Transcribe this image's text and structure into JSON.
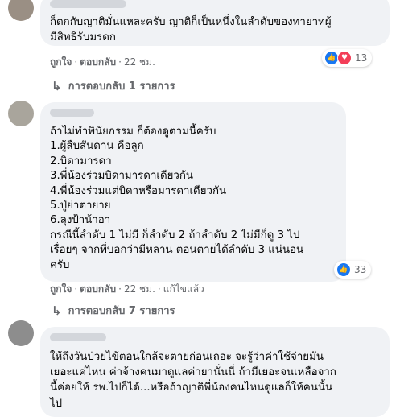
{
  "colors": {
    "bubble": "#f0f2f5",
    "meta_text": "#65676b",
    "like_blue": "#1877f2",
    "love_red": "#f33e58"
  },
  "comments": [
    {
      "lines": [
        "ก็ตกกับญาติมั่นแหละครับ ญาติก็เป็นหนึ่งในลำดับของทายาทผู้",
        "มีสิทธิรับมรดก"
      ],
      "actions": {
        "like": "ถูกใจ",
        "reply": "ตอบกลับ",
        "time": "22 ชม."
      },
      "reactions": {
        "icons": [
          "like-icon",
          "love-icon"
        ],
        "count": "13"
      },
      "replies_label": "การตอบกลับ 1 รายการ"
    },
    {
      "lines": [
        "ถ้าไม่ทำพินัยกรรม ก็ต้องดูตามนี้ครับ",
        "1.ผู้สืบสันดาน คือลูก",
        "2.บิดามารดา",
        "3.พี่น้องร่วมบิดามารดาเดียวกัน",
        "4.พี่น้องร่วมแต่บิดาหรือมารดาเดียวกัน",
        "5.ปู่ย่าตายาย",
        "6.ลุงป้าน้าอา",
        "กรณีนี้ลำดับ 1 ไม่มี ก็ลำดับ 2 ถ้าลำดับ 2 ไม่มีก็ดู 3 ไป",
        "เรื่อยๆ จากที่บอกว่ามีหลาน ตอนตายได้ลำดับ 3 แน่นอน",
        "ครับ"
      ],
      "actions": {
        "like": "ถูกใจ",
        "reply": "ตอบกลับ",
        "time": "22 ชม.",
        "edited": "แก้ไขแล้ว"
      },
      "reactions": {
        "icons": [
          "like-icon"
        ],
        "count": "33"
      },
      "replies_label": "การตอบกลับ 7 รายการ"
    },
    {
      "lines": [
        "ให้ถึงวันป่วยไข้ตอนใกล้จะตายก่อนเถอะ จะรู้ว่าค่าใช้จ่ายมัน",
        "เยอะแค่ไหน ค่าจ้างคนมาดูแลค่ายานั่นนี่ ถ้ามีเยอะจนเหลือจาก",
        "นี้ค่อยให้ รพ.ไปก็ได้...หรือถ้าญาติพี่น้องคนไหนดูแลก็ให้คนนั้น",
        "ไป"
      ]
    }
  ]
}
